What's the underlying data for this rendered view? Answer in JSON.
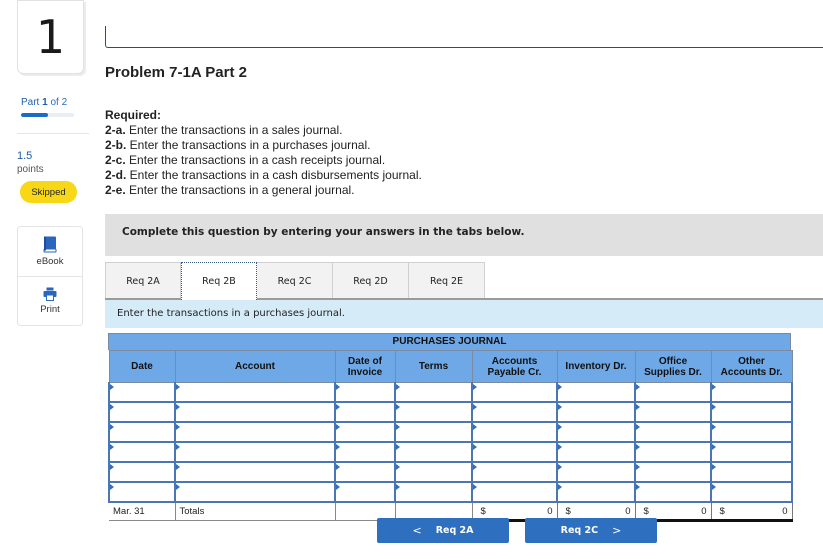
{
  "sidebar": {
    "question_number": "1",
    "part": {
      "prefix": "Part",
      "current": "1",
      "of_text": "of 2",
      "progress_fraction": 0.5
    },
    "points": {
      "value": "1.5",
      "label": "points"
    },
    "status_badge": "Skipped",
    "tools": [
      {
        "label": "eBook",
        "icon": "book-icon"
      },
      {
        "label": "Print",
        "icon": "printer-icon"
      }
    ]
  },
  "problem": {
    "title": "Problem 7-1A Part 2",
    "required_heading": "Required:",
    "requirements": [
      {
        "key": "2-a.",
        "text": " Enter the transactions in a sales journal."
      },
      {
        "key": "2-b.",
        "text": " Enter the transactions in a purchases journal."
      },
      {
        "key": "2-c.",
        "text": " Enter the transactions in a cash receipts journal."
      },
      {
        "key": "2-d.",
        "text": " Enter the transactions in a cash disbursements journal."
      },
      {
        "key": "2-e.",
        "text": " Enter the transactions in a general journal."
      }
    ]
  },
  "instructions_banner": "Complete this question by entering your answers in the tabs below.",
  "tabs": [
    {
      "label": "Req 2A",
      "active": false
    },
    {
      "label": "Req 2B",
      "active": true
    },
    {
      "label": "Req 2C",
      "active": false
    },
    {
      "label": "Req 2D",
      "active": false
    },
    {
      "label": "Req 2E",
      "active": false
    }
  ],
  "tab_instruction": "Enter the transactions in a purchases journal.",
  "journal": {
    "title": "PURCHASES JOURNAL",
    "columns": [
      {
        "line1": "Date",
        "line2": ""
      },
      {
        "line1": "Account",
        "line2": ""
      },
      {
        "line1": "Date of",
        "line2": "Invoice"
      },
      {
        "line1": "Terms",
        "line2": ""
      },
      {
        "line1": "Accounts",
        "line2": "Payable Cr."
      },
      {
        "line1": "Inventory Dr.",
        "line2": ""
      },
      {
        "line1": "Office",
        "line2": "Supplies Dr."
      },
      {
        "line1": "Other",
        "line2": "Accounts Dr."
      }
    ],
    "rows": [
      [
        "",
        "",
        "",
        "",
        "",
        "",
        "",
        ""
      ],
      [
        "",
        "",
        "",
        "",
        "",
        "",
        "",
        ""
      ],
      [
        "",
        "",
        "",
        "",
        "",
        "",
        "",
        ""
      ],
      [
        "",
        "",
        "",
        "",
        "",
        "",
        "",
        ""
      ],
      [
        "",
        "",
        "",
        "",
        "",
        "",
        "",
        ""
      ],
      [
        "",
        "",
        "",
        "",
        "",
        "",
        "",
        ""
      ]
    ],
    "totals": {
      "date": "Mar. 31",
      "label": "Totals",
      "currency_symbol": "$",
      "accounts_payable_cr": "0",
      "inventory_dr": "0",
      "office_supplies_dr": "0",
      "other_accounts_dr": "0"
    }
  },
  "navigation": {
    "prev_label": "Req 2A",
    "next_label": "Req 2C",
    "prev_chevron": "<",
    "next_chevron": ">"
  },
  "colors": {
    "accent_blue": "#2e6fc0",
    "table_header": "#6fa8e6",
    "skipped_badge": "#f8d816",
    "instruction_bg": "#d6ebf8"
  }
}
